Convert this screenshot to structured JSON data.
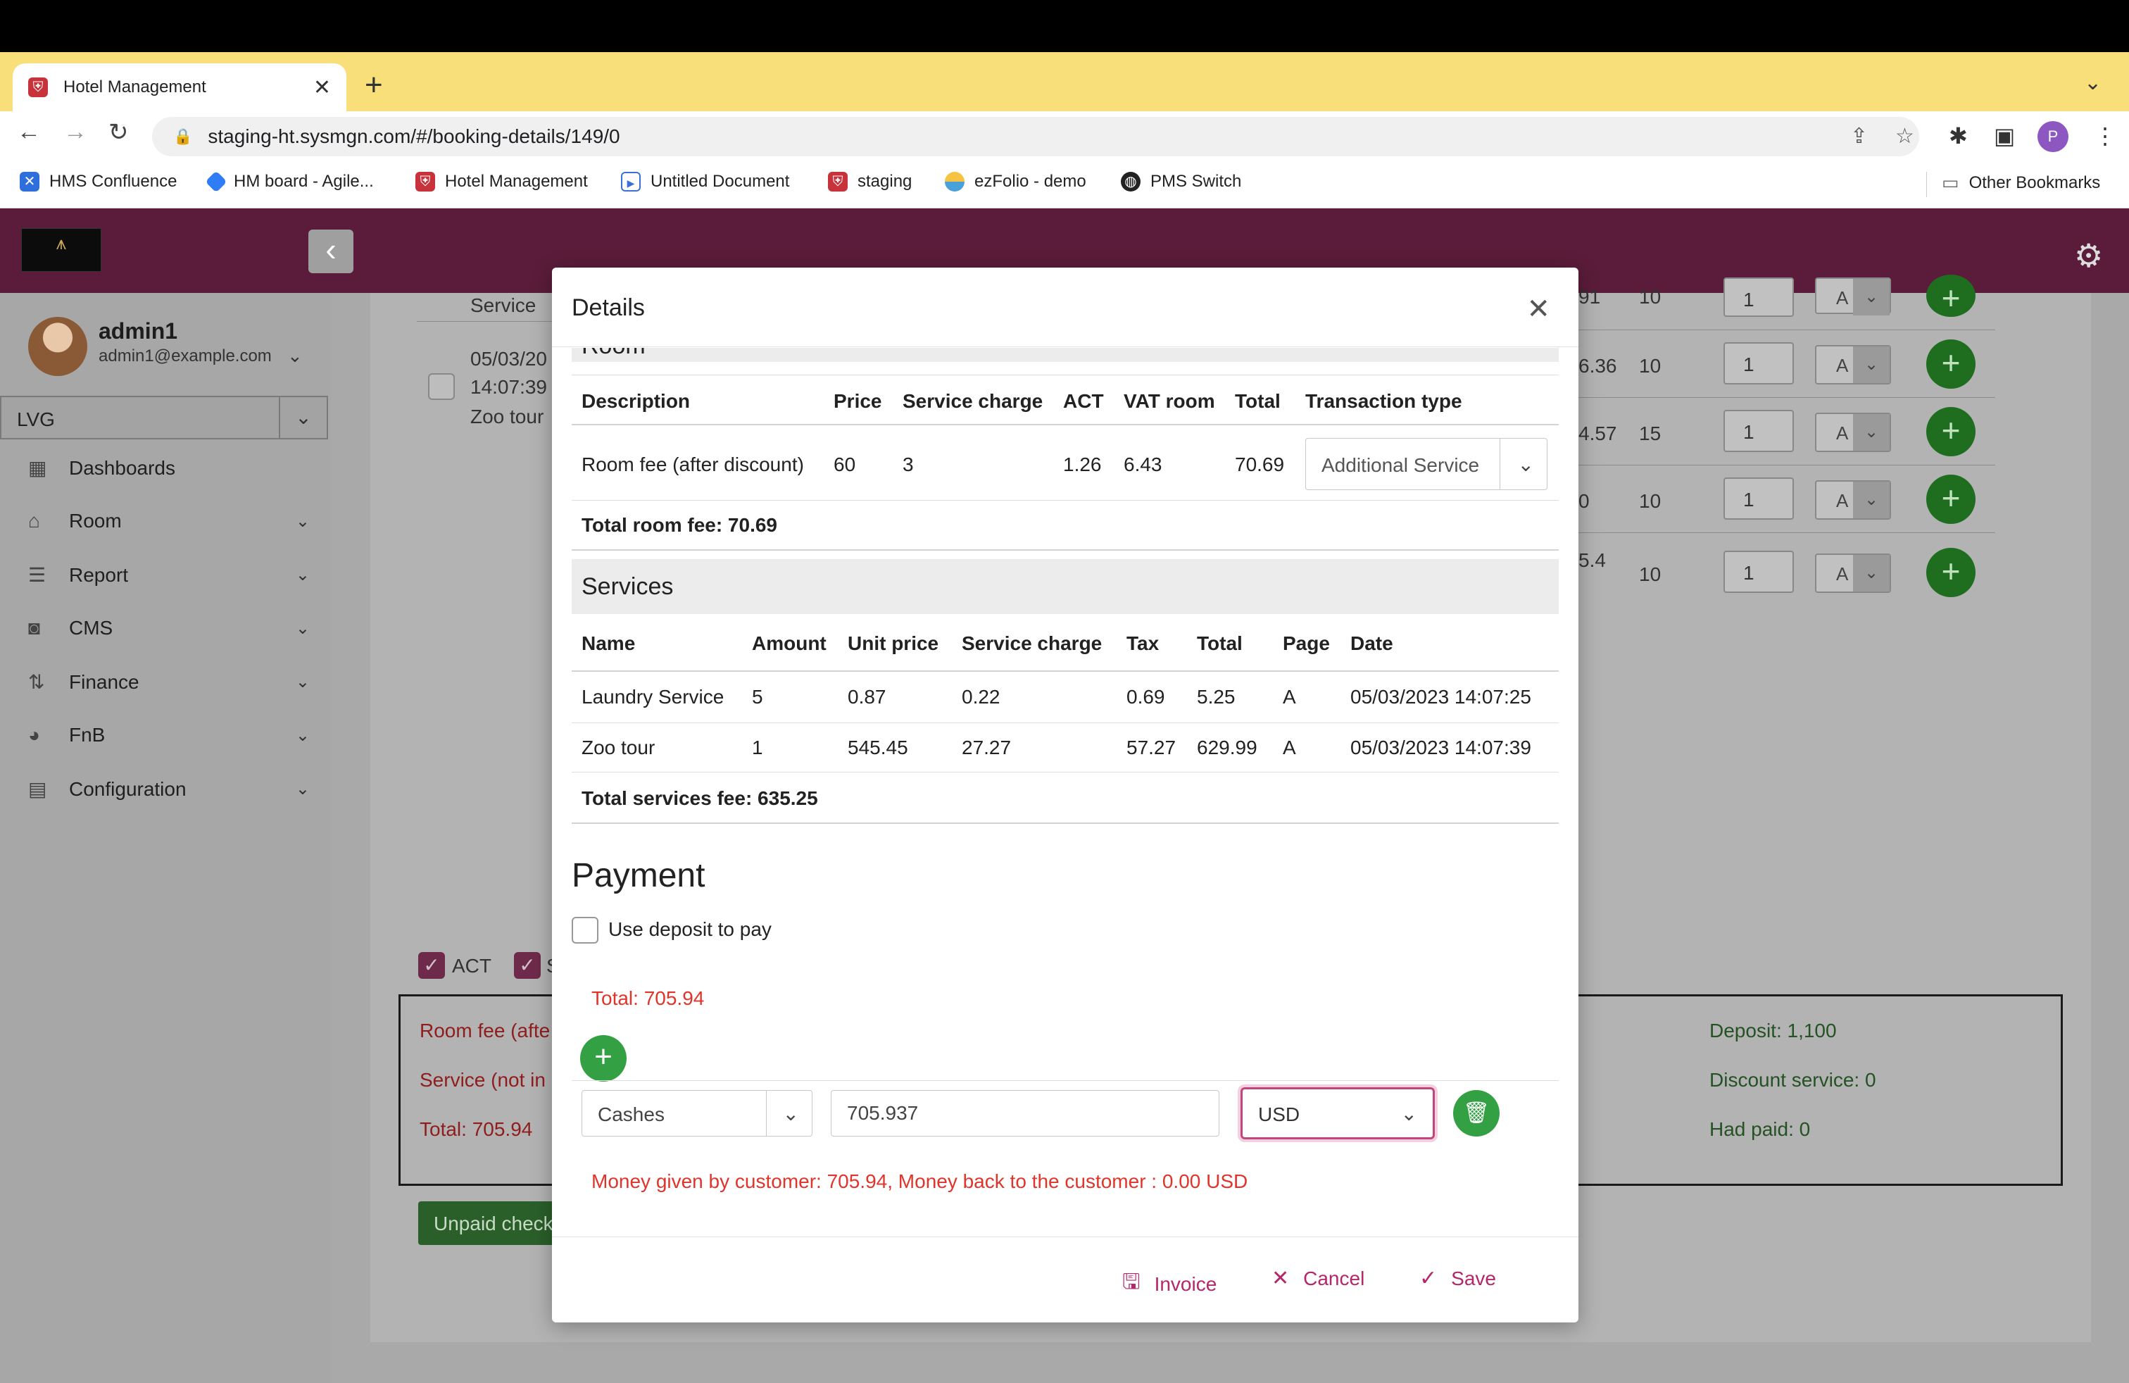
{
  "browser": {
    "tab_title": "Hotel Management",
    "url": "staging-ht.sysmgn.com/#/booking-details/149/0",
    "profile_initial": "P",
    "bookmarks": [
      "HMS Confluence",
      "HM board - Agile...",
      "Hotel Management",
      "Untitled Document",
      "staging",
      "ezFolio - demo",
      "PMS Switch"
    ],
    "other_bookmarks": "Other Bookmarks"
  },
  "sidebar": {
    "user_name": "admin1",
    "user_email": "admin1@example.com",
    "hotel": "LVG",
    "items": [
      {
        "label": "Dashboards",
        "icon": "grid-icon"
      },
      {
        "label": "Room",
        "icon": "home-icon"
      },
      {
        "label": "Report",
        "icon": "list-icon"
      },
      {
        "label": "CMS",
        "icon": "camera-icon"
      },
      {
        "label": "Finance",
        "icon": "arrows-icon"
      },
      {
        "label": "FnB",
        "icon": "palette-icon"
      },
      {
        "label": "Configuration",
        "icon": "briefcase-icon"
      }
    ]
  },
  "background": {
    "service_label": "Service",
    "row_date": "05/03/20",
    "row_time": "14:07:39",
    "row_name": "Zoo tour",
    "partial_values": [
      "91",
      "6.36",
      "4.57",
      "0",
      "5.4"
    ],
    "qty_values": [
      "10",
      "10",
      "15",
      "10",
      "10"
    ],
    "input_value": "1",
    "select_value": "A",
    "check_act": "ACT",
    "check_s": "S",
    "summary_left": [
      "Room fee (afte",
      "Service (not in",
      "Total: 705.94"
    ],
    "summary_right": [
      "Deposit: 1,100",
      "Discount service: 0",
      "Had paid: 0"
    ],
    "unpaid_button": "Unpaid check"
  },
  "modal": {
    "title": "Details",
    "room_section": "Room",
    "room_headers": [
      "Description",
      "Price",
      "Service charge",
      "ACT",
      "VAT room",
      "Total",
      "Transaction type"
    ],
    "room_row": {
      "description": "Room fee (after discount)",
      "price": "60",
      "service_charge": "3",
      "act": "1.26",
      "vat": "6.43",
      "total": "70.69",
      "transaction_type": "Additional Service"
    },
    "room_total": "Total room fee: 70.69",
    "services_section": "Services",
    "service_headers": [
      "Name",
      "Amount",
      "Unit price",
      "Service charge",
      "Tax",
      "Total",
      "Page",
      "Date"
    ],
    "service_rows": [
      {
        "name": "Laundry Service",
        "amount": "5",
        "unit_price": "0.87",
        "service_charge": "0.22",
        "tax": "0.69",
        "total": "5.25",
        "page": "A",
        "date": "05/03/2023 14:07:25"
      },
      {
        "name": "Zoo tour",
        "amount": "1",
        "unit_price": "545.45",
        "service_charge": "27.27",
        "tax": "57.27",
        "total": "629.99",
        "page": "A",
        "date": "05/03/2023 14:07:39"
      }
    ],
    "services_total": "Total services fee: 635.25",
    "payment": {
      "title": "Payment",
      "use_deposit_label": "Use deposit to pay",
      "total": "Total: 705.94",
      "method": "Cashes",
      "amount": "705.937",
      "currency": "USD",
      "note": "Money given by customer: 705.94, Money back to the customer : 0.00 USD"
    },
    "footer": {
      "invoice": "Invoice",
      "cancel": "Cancel",
      "save": "Save"
    }
  },
  "colors": {
    "brand": "#7a2850",
    "accent_pink": "#b5266a",
    "green": "#33a043",
    "error_red": "#e0352b"
  }
}
